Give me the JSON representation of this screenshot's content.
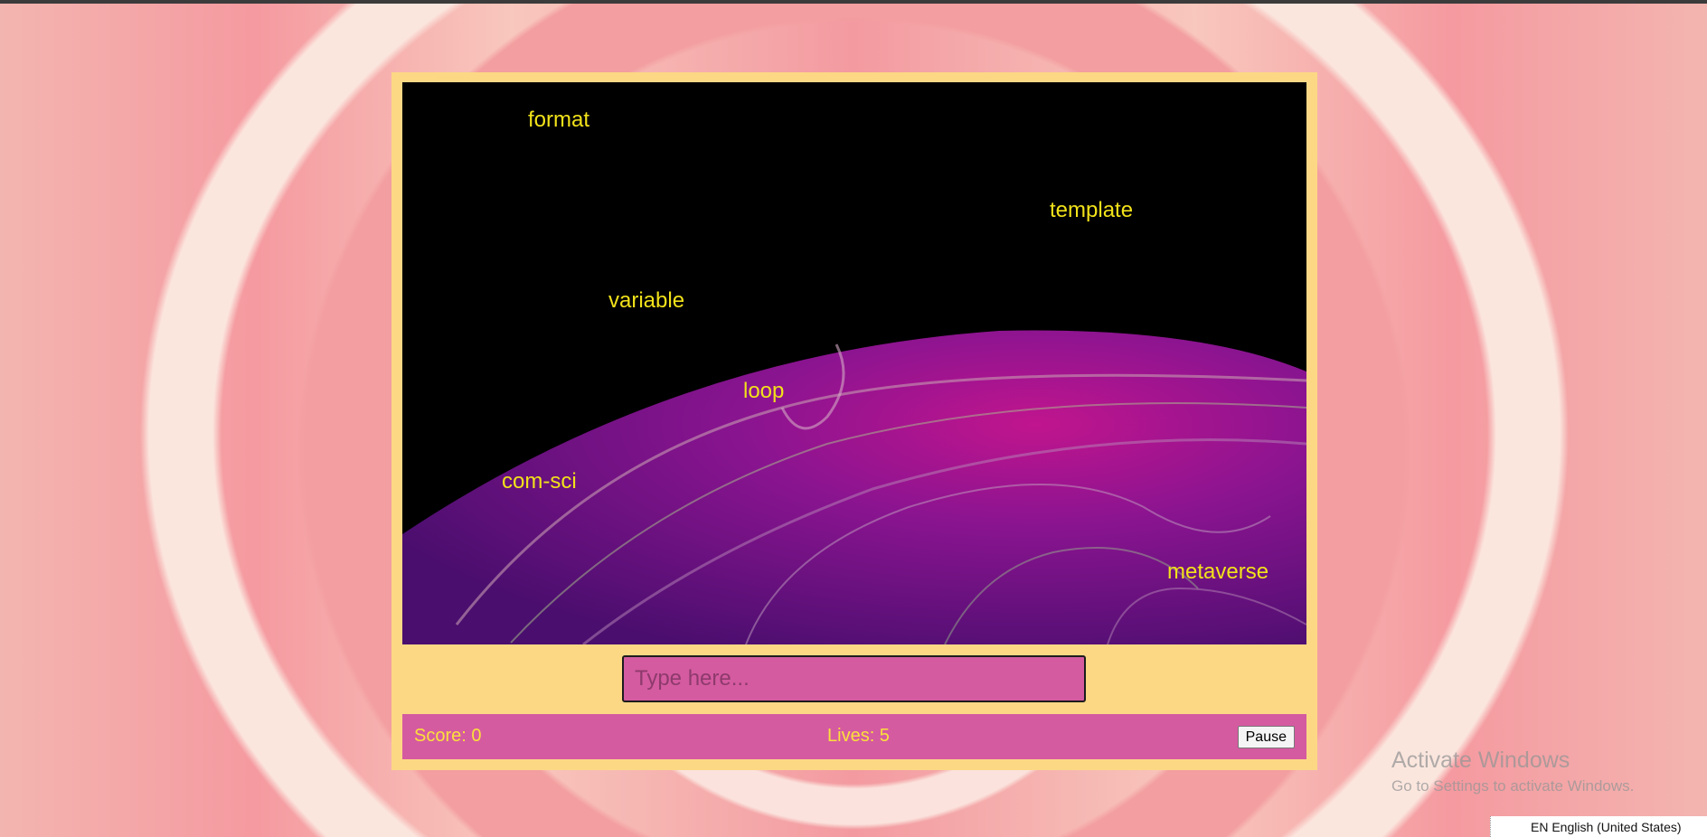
{
  "game": {
    "words": [
      {
        "text": "format"
      },
      {
        "text": "template"
      },
      {
        "text": "variable"
      },
      {
        "text": "loop"
      },
      {
        "text": "com-sci"
      },
      {
        "text": "metaverse"
      }
    ],
    "input_placeholder": "Type here...",
    "input_value": "",
    "score_label": "Score: 0",
    "lives_label": "Lives: 5",
    "pause_label": "Pause"
  },
  "colors": {
    "frame": "#fcd885",
    "status_bar": "#d45ba0",
    "input_bg": "#d45ba0",
    "word_text": "#f2e21a",
    "status_text": "#fce03a"
  },
  "os": {
    "activate_title": "Activate Windows",
    "activate_sub": "Go to Settings to activate Windows.",
    "language": "EN English (United States)"
  }
}
